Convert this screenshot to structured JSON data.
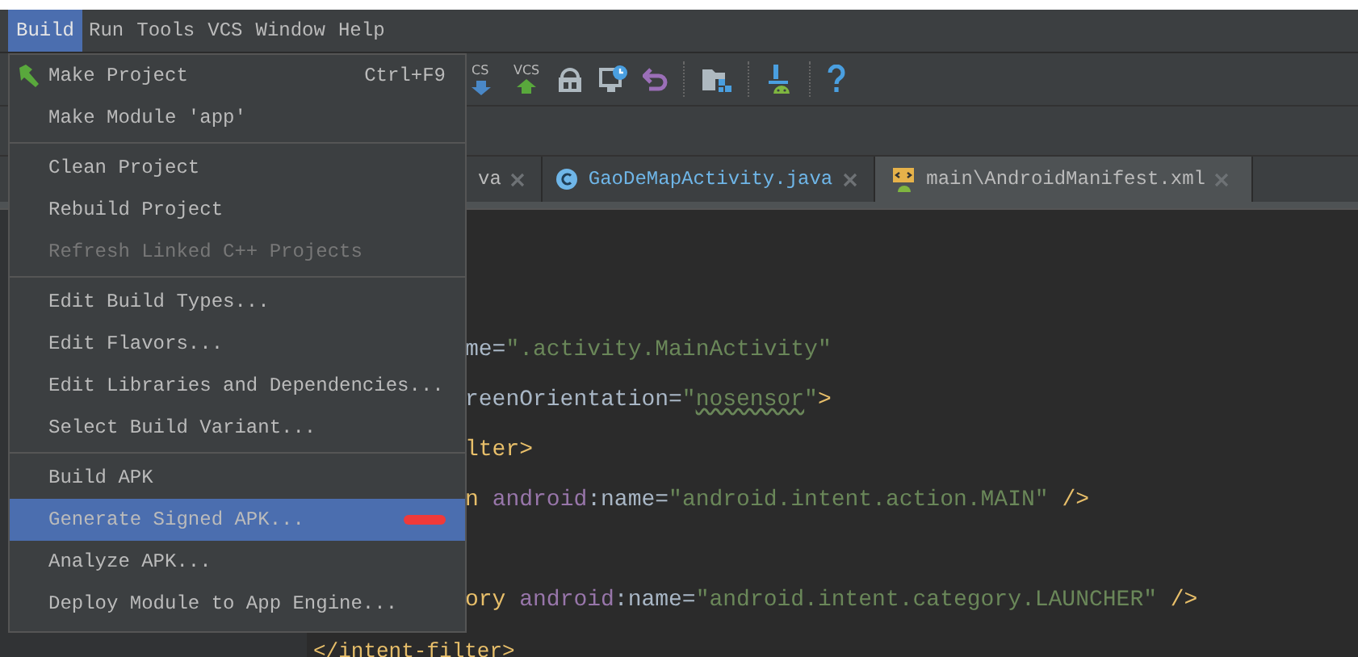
{
  "menu_bar": [
    {
      "label": "Build",
      "selected": true
    },
    {
      "label": "Run",
      "selected": false
    },
    {
      "label": "Tools",
      "selected": false
    },
    {
      "label": "VCS",
      "selected": false
    },
    {
      "label": "Window",
      "selected": false
    },
    {
      "label": "Help",
      "selected": false
    }
  ],
  "toolbar": {
    "vcs_labels": [
      "CS",
      "VCS"
    ]
  },
  "tabs": [
    {
      "label": "va",
      "kind": "partial",
      "selected": false
    },
    {
      "label": "GaoDeMapActivity.java",
      "kind": "java",
      "selected": false
    },
    {
      "label": "main\\AndroidManifest.xml",
      "kind": "xml",
      "selected": true
    }
  ],
  "build_menu": [
    {
      "kind": "item",
      "label": "Make Project",
      "shortcut": "Ctrl+F9",
      "disabled": false,
      "selected": false,
      "marked": false
    },
    {
      "kind": "item",
      "label": "Make Module 'app'",
      "disabled": false,
      "selected": false,
      "marked": false
    },
    {
      "kind": "separator"
    },
    {
      "kind": "item",
      "label": "Clean Project",
      "disabled": false,
      "selected": false,
      "marked": false
    },
    {
      "kind": "item",
      "label": "Rebuild Project",
      "disabled": false,
      "selected": false,
      "marked": false
    },
    {
      "kind": "item",
      "label": "Refresh Linked C++ Projects",
      "disabled": true,
      "selected": false,
      "marked": false
    },
    {
      "kind": "separator"
    },
    {
      "kind": "item",
      "label": "Edit Build Types...",
      "disabled": false,
      "selected": false,
      "marked": false
    },
    {
      "kind": "item",
      "label": "Edit Flavors...",
      "disabled": false,
      "selected": false,
      "marked": false
    },
    {
      "kind": "item",
      "label": "Edit Libraries and Dependencies...",
      "disabled": false,
      "selected": false,
      "marked": false
    },
    {
      "kind": "item",
      "label": "Select Build Variant...",
      "disabled": false,
      "selected": false,
      "marked": false
    },
    {
      "kind": "separator"
    },
    {
      "kind": "item",
      "label": "Build APK",
      "disabled": false,
      "selected": false,
      "marked": false
    },
    {
      "kind": "item",
      "label": "Generate Signed APK...",
      "disabled": false,
      "selected": true,
      "marked": true
    },
    {
      "kind": "item",
      "label": "Analyze APK...",
      "disabled": false,
      "selected": false,
      "marked": false
    },
    {
      "kind": "item",
      "label": "Deploy Module to App Engine...",
      "disabled": false,
      "selected": false,
      "marked": false
    }
  ],
  "editor": {
    "lines": [
      {
        "segments": [
          {
            "kind": "plain",
            "text": "me="
          },
          {
            "kind": "string",
            "text": "\".activity.MainActivity\""
          }
        ]
      },
      {
        "segments": [
          {
            "kind": "plain",
            "text": "reenOrientation="
          },
          {
            "kind": "string",
            "text": "\""
          },
          {
            "kind": "typo",
            "text": "nosensor"
          },
          {
            "kind": "string",
            "text": "\""
          },
          {
            "kind": "tag",
            "text": ">"
          }
        ]
      },
      {
        "segments": [
          {
            "kind": "tag",
            "text": "lter>"
          }
        ]
      },
      {
        "segments": [
          {
            "kind": "tag",
            "text": "n "
          },
          {
            "kind": "namespace",
            "text": "android"
          },
          {
            "kind": "plain",
            "text": ":name="
          },
          {
            "kind": "string",
            "text": "\"android.intent.action.MAIN\""
          },
          {
            "kind": "tag",
            "text": " />"
          }
        ]
      },
      {
        "blank_line_before": true,
        "segments": [
          {
            "kind": "tag",
            "text": "ory "
          },
          {
            "kind": "namespace",
            "text": "android"
          },
          {
            "kind": "plain",
            "text": ":name="
          },
          {
            "kind": "string",
            "text": "\"android.intent.category.LAUNCHER\""
          },
          {
            "kind": "tag",
            "text": " />"
          }
        ]
      }
    ],
    "footer_line": {
      "segments": [
        {
          "kind": "tag",
          "text": "</intent-filter>"
        }
      ]
    }
  }
}
